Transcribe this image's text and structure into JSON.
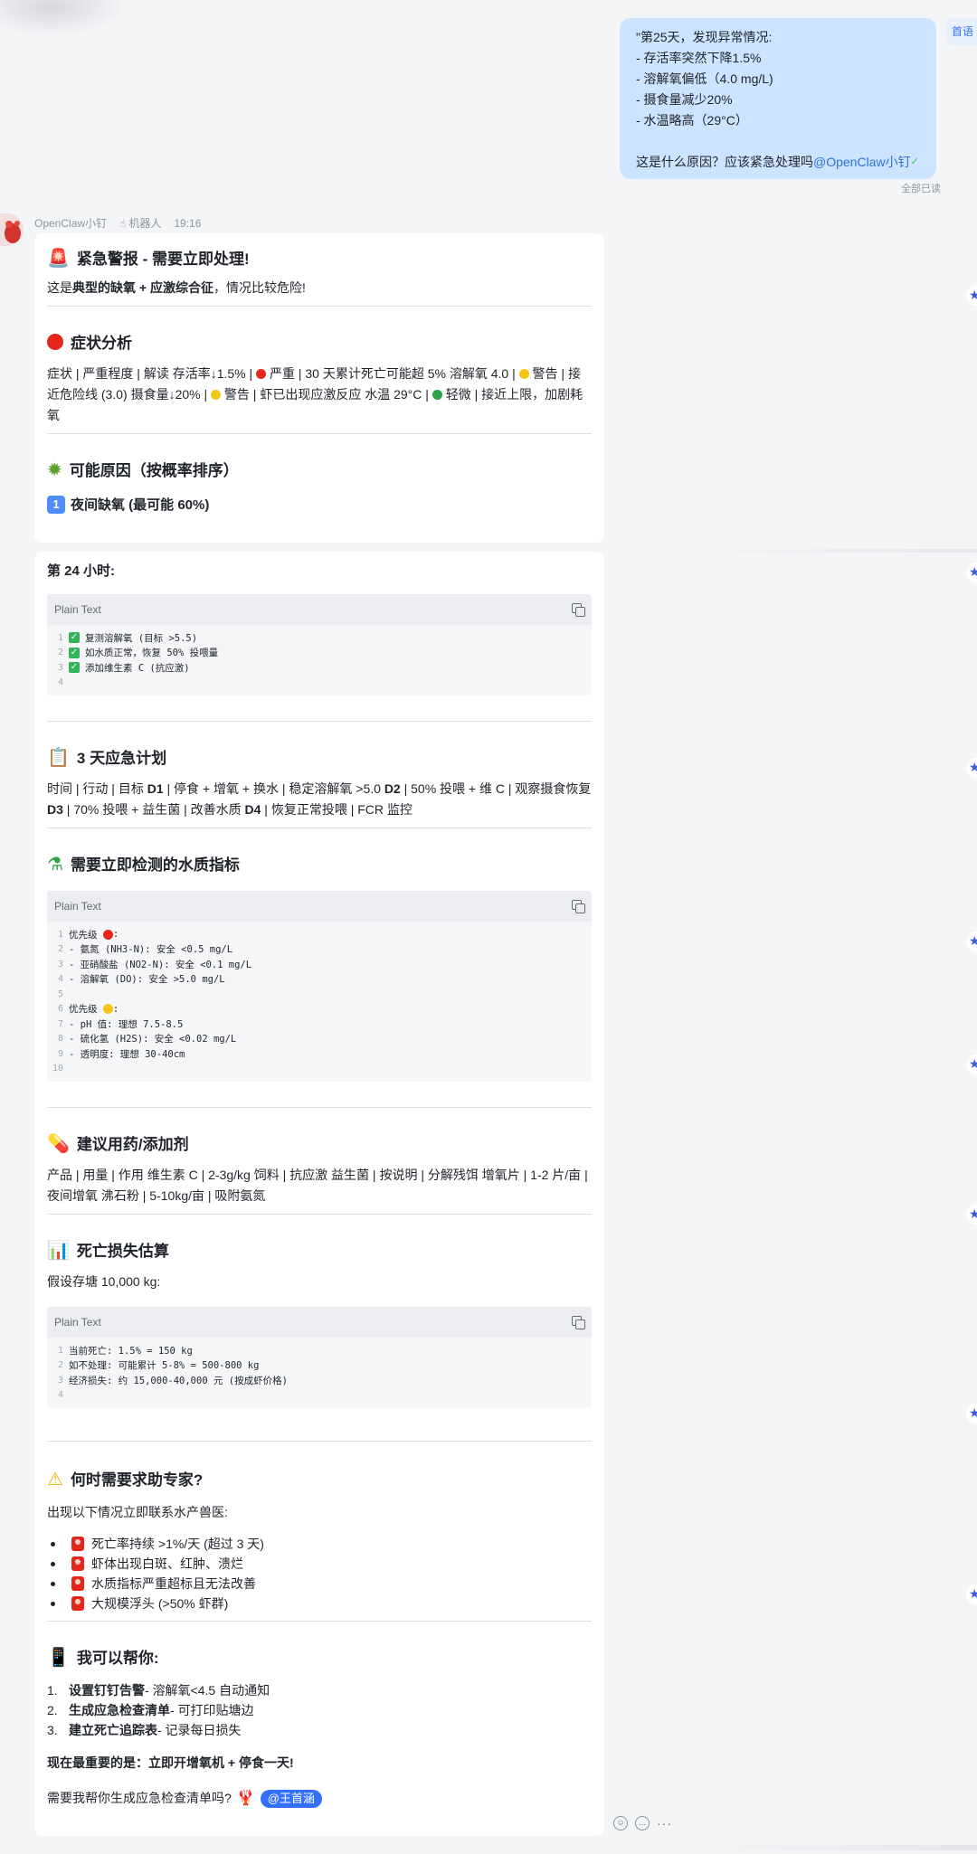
{
  "side_tag": "首语",
  "user_message": {
    "lines": [
      "\"第25天，发现异常情况:",
      "- 存活率突然下降1.5%",
      "- 溶解氧偏低（4.0 mg/L)",
      "- 摄食量减少20%",
      "- 水温略高（29°C）",
      "",
      "这是什么原因？应该紧急处理吗"
    ],
    "mention": "@OpenClaw小钉",
    "read_status": "全部已读"
  },
  "bot": {
    "name": "OpenClaw小钉",
    "tag": "机器人",
    "time": "19:16"
  },
  "card_a": {
    "alert_title": "紧急警报 - 需要立即处理!",
    "intro_prefix": "这是",
    "intro_bold": "典型的缺氧 + 应激综合征",
    "intro_suffix": "，情况比较危险!",
    "symptom_title": "症状分析",
    "symptom_p1": "症状 | 严重程度 | 解读 存活率↓1.5% |",
    "symptom_p2": "严重 | 30 天累计死亡可能超 5% 溶解氧 4.0 |",
    "symptom_p3": "警告 |",
    "symptom_p4": "接近危险线 (3.0) 摄食量↓20% |",
    "symptom_p5": "警告 | 虾已出现应激反应 水温 29°C |",
    "symptom_p6": "轻微 | 接近上限，加剧耗氧",
    "cause_title": "可能原因（按概率排序）",
    "cause1_num": "1",
    "cause1_title": "夜间缺氧 (最可能 60%)"
  },
  "card_b": {
    "h24_title": "第 24 小时:",
    "code1": {
      "label": "Plain Text",
      "lines": [
        "复测溶解氧 (目标 >5.5)",
        "如水质正常，恢复 50% 投喂量",
        "添加维生素 C (抗应激)",
        ""
      ]
    },
    "plan_title": "3 天应急计划",
    "plan_p1": "时间 | 行动 | 目标",
    "plan_d1": "D1",
    "plan_p2": "| 停食 + 增氧 + 换水 | 稳定溶解氧 >5.0",
    "plan_d2": "D2",
    "plan_p3": "| 50% 投喂 + 维 C | 观察摄食恢复",
    "plan_d3": "D3",
    "plan_p4": "| 70% 投喂 + 益生菌 | 改善水质",
    "plan_d4": "D4",
    "plan_p5": "| 恢复正常投喂 | FCR 监控",
    "water_title": "需要立即检测的水质指标",
    "code2": {
      "label": "Plain Text",
      "l1": "优先级",
      "l2": "- 氨氮 (NH3-N): 安全 <0.5 mg/L",
      "l3": "- 亚硝酸盐 (NO2-N): 安全 <0.1 mg/L",
      "l4": "- 溶解氧 (DO): 安全 >5.0 mg/L",
      "l6": "优先级",
      "l7": "- pH 值: 理想 7.5-8.5",
      "l8": "- 硫化氢 (H2S): 安全 <0.02 mg/L",
      "l9": "- 透明度: 理想 30-40cm",
      "colon": ":"
    },
    "med_title": "建议用药/添加剂",
    "med_p": "产品 | 用量 | 作用 维生素 C | 2-3g/kg 饲料 | 抗应激 益生菌 | 按说明 | 分解残饵 增氧片 | 1-2 片/亩 | 夜间增氧 沸石粉 | 5-10kg/亩 | 吸附氨氮",
    "loss_title": "死亡损失估算",
    "loss_intro": "假设存塘 10,000 kg:",
    "code3": {
      "label": "Plain Text",
      "lines": [
        "当前死亡: 1.5% = 150 kg",
        "如不处理: 可能累计 5-8% = 500-800 kg",
        "经济损失: 约 15,000-40,000 元 (按成虾价格)",
        ""
      ]
    },
    "expert_title": "何时需要求助专家?",
    "expert_intro": "出现以下情况立即联系水产兽医:",
    "expert_items": [
      "死亡率持续 >1%/天 (超过 3 天)",
      "虾体出现白斑、红肿、溃烂",
      "水质指标严重超标且无法改善",
      "大规模浮头 (>50% 虾群)"
    ],
    "help_title": "我可以帮你:",
    "help_items": [
      {
        "num": "1.",
        "bold": "设置钉钉告警",
        "rest": " - 溶解氧<4.5 自动通知"
      },
      {
        "num": "2.",
        "bold": "生成应急检查清单",
        "rest": " - 可打印贴塘边"
      },
      {
        "num": "3.",
        "bold": "建立死亡追踪表",
        "rest": " - 记录每日损失"
      }
    ],
    "most_important": "现在最重要的是：立即开增氧机 + 停食一天!",
    "ask": "需要我帮你生成应急检查清单吗?",
    "mention_chip": "@王首涵"
  },
  "icons": {
    "alert": "rotating-light-icon",
    "symptom": "red-circle-icon",
    "cause": "microbe-icon",
    "plan": "clipboard-icon",
    "water": "test-tube-icon",
    "med": "pill-icon",
    "loss": "bar-chart-icon",
    "expert": "warning-icon",
    "help": "mobile-phone-icon",
    "lobster": "lobster-icon"
  },
  "colors": {
    "accent": "#3370ff",
    "user_bubble": "#cce4ff",
    "danger": "#e5261b",
    "warn": "#f5c518",
    "ok": "#2aa345"
  }
}
